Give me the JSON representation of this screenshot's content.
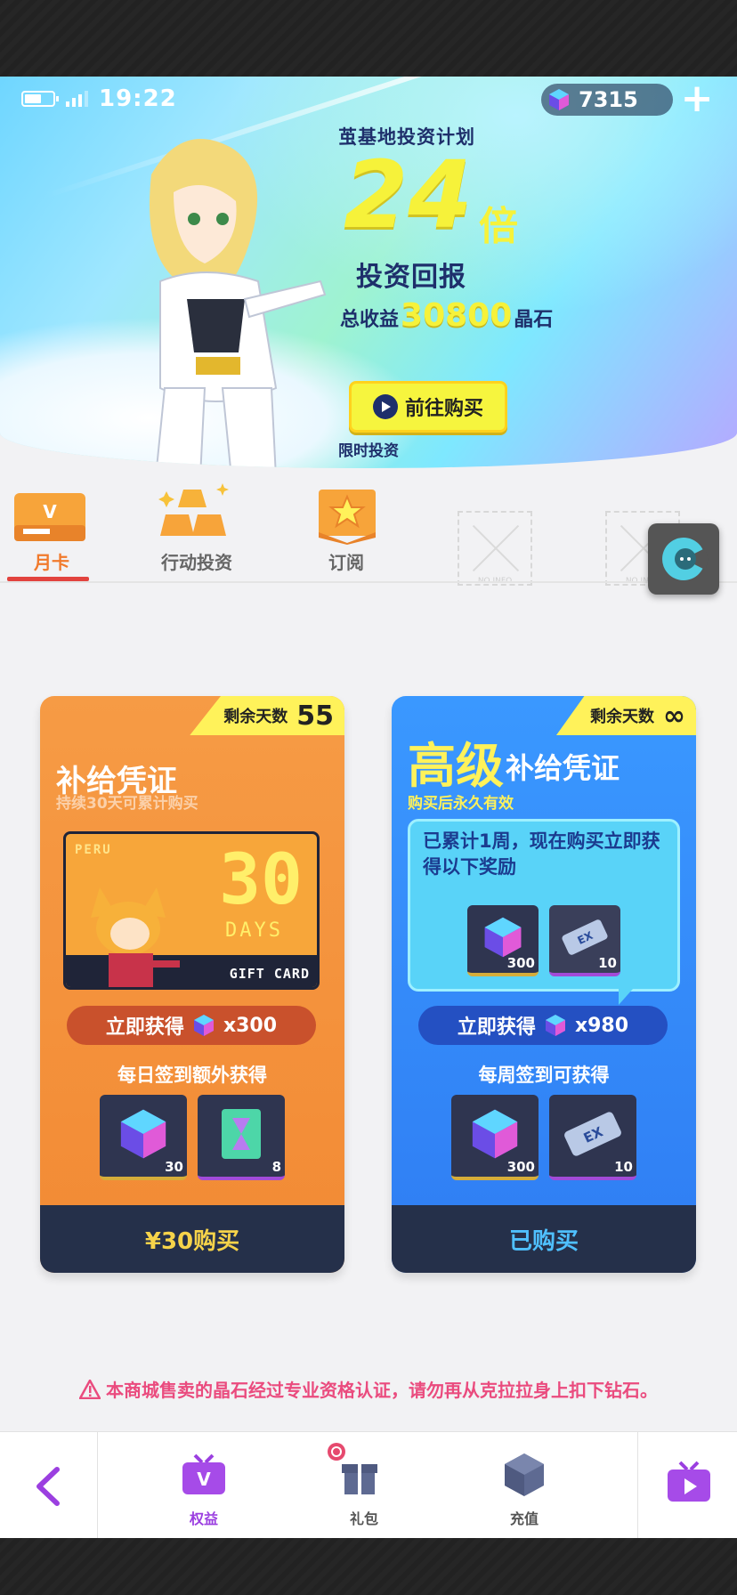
{
  "status_bar": {
    "time": "19:22"
  },
  "currency": {
    "gems": "7315",
    "plus_label": "+"
  },
  "banner": {
    "title": "茧基地投资计划",
    "multiplier": "24",
    "multiplier_unit": "倍",
    "subtitle": "投资回报",
    "total_prefix": "总收益",
    "total_value": "30800",
    "total_suffix": "晶石",
    "button_label": "前往购买",
    "limited_label": "限时投资"
  },
  "tabs": [
    {
      "label": "月卡",
      "active": true
    },
    {
      "label": "行动投资",
      "active": false
    },
    {
      "label": "订阅",
      "active": false
    },
    {
      "label": "NO INFO",
      "active": false
    },
    {
      "label": "NO INFO",
      "active": false
    }
  ],
  "card_basic": {
    "days_label": "剩余天数",
    "days_value": "55",
    "title": "补给凭证",
    "subtitle": "持续30天可累计购买",
    "gift": {
      "brand": "PERU",
      "number": "30",
      "days": "DAYS",
      "caption": "GIFT CARD"
    },
    "instant_label": "立即获得",
    "instant_amount": "x300",
    "daily_heading": "每日签到额外获得",
    "items": [
      {
        "icon": "crystal-cube-icon",
        "count": "30"
      },
      {
        "icon": "hourglass-ticket-icon",
        "count": "8"
      }
    ],
    "footer_label": "¥30购买"
  },
  "card_premium": {
    "days_label": "剩余天数",
    "days_value": "∞",
    "title_big": "高级",
    "title_rest": "补给凭证",
    "subtitle": "购买后永久有效",
    "bubble_text": "已累计1周，现在购买立即获得以下奖励",
    "bubble_items": [
      {
        "icon": "crystal-cube-icon",
        "count": "300"
      },
      {
        "icon": "ticket-icon",
        "count": "10"
      }
    ],
    "instant_label": "立即获得",
    "instant_amount": "x980",
    "weekly_heading": "每周签到可获得",
    "items": [
      {
        "icon": "crystal-cube-icon",
        "count": "300"
      },
      {
        "icon": "ticket-icon",
        "count": "10"
      }
    ],
    "footer_label": "已购买"
  },
  "warning": "本商城售卖的晶石经过专业资格认证，请勿再从克拉拉身上扣下钻石。",
  "nav": {
    "items": [
      {
        "label": "权益",
        "icon": "tv-v-icon",
        "active": true
      },
      {
        "label": "礼包",
        "icon": "gift-icon",
        "active": false
      },
      {
        "label": "充值",
        "icon": "cube-icon",
        "active": false
      }
    ]
  },
  "colors": {
    "accent_orange": "#f17a2c",
    "accent_purple": "#9b3fe0",
    "gem_yellow": "#f6f23a",
    "warning_pink": "#ea4b7e"
  }
}
